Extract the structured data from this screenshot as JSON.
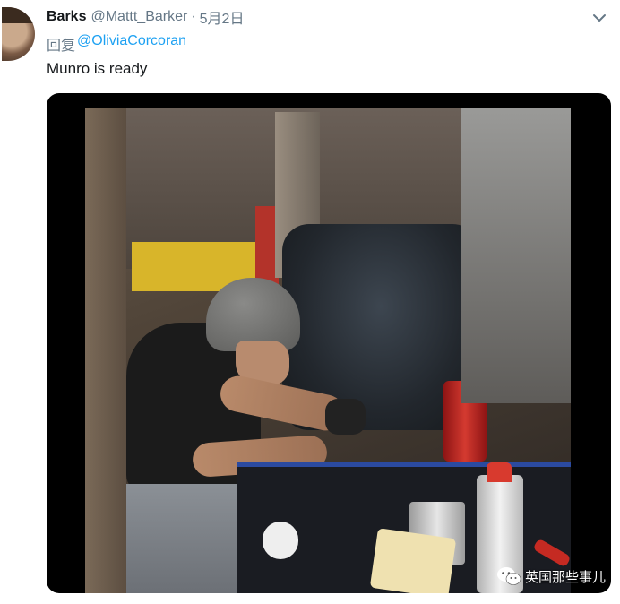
{
  "tweet": {
    "author_name": "Barks",
    "author_handle": "@Mattt_Barker",
    "separator": "·",
    "date": "5月2日",
    "reply_label": "回复",
    "reply_mention": "@OliviaCorcoran_",
    "text": "Munro is ready"
  },
  "media": {
    "watermark_text": "英国那些事儿",
    "watermark_icon": "wechat-icon"
  },
  "colors": {
    "text_primary": "#14171a",
    "text_secondary": "#657786",
    "link": "#1da1f2"
  }
}
